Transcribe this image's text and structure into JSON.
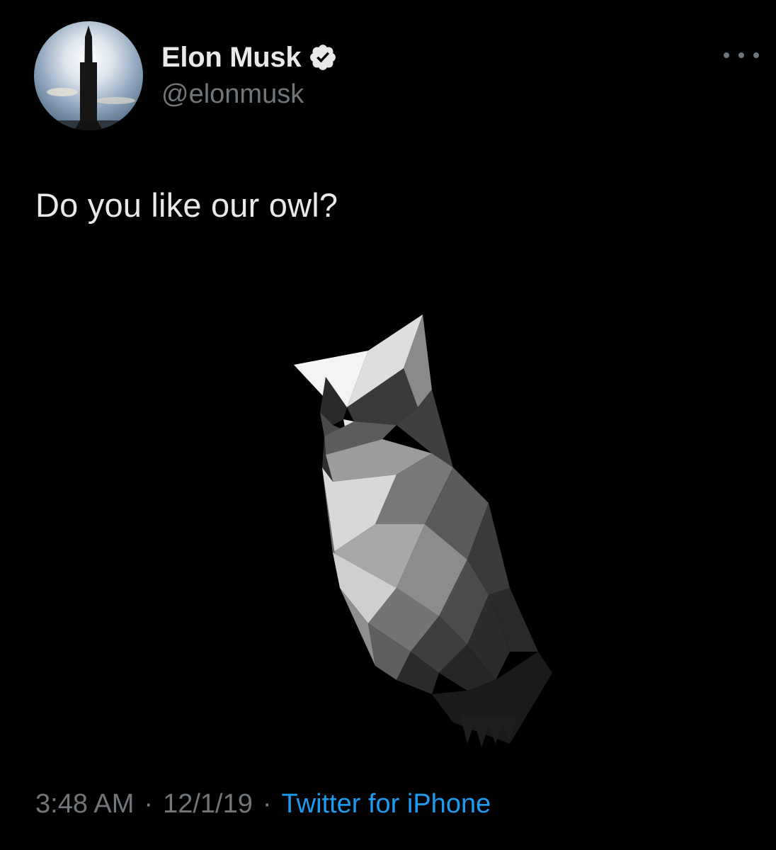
{
  "author": {
    "name": "Elon Musk",
    "handle": "@elonmusk",
    "verified": true
  },
  "tweet": {
    "text": "Do you like our owl?",
    "time": "3:48 AM",
    "date": "12/1/19",
    "separator": "·",
    "source": "Twitter for iPhone"
  },
  "icons": {
    "more": "more-horizontal-icon",
    "verified": "verified-badge-icon"
  },
  "colors": {
    "background": "#000000",
    "primary_text": "#e7e9ea",
    "secondary_text": "#71767b",
    "link": "#1d9bf0"
  }
}
